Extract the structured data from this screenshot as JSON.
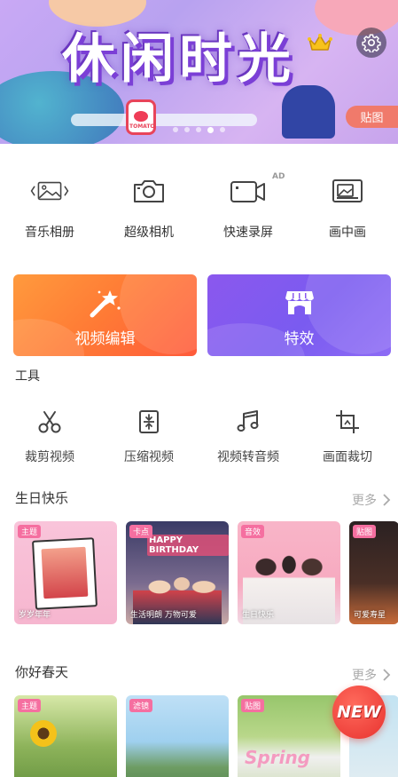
{
  "banner": {
    "title": "休闲时光",
    "sticker_tag": "贴图",
    "tomato_label": "TOMATO",
    "slide_count": 5,
    "active_slide": 3
  },
  "quick_actions": [
    {
      "label": "音乐相册",
      "icon": "photo-album-icon"
    },
    {
      "label": "超级相机",
      "icon": "camera-icon"
    },
    {
      "label": "快速录屏",
      "icon": "screen-record-icon",
      "badge": "AD"
    },
    {
      "label": "画中画",
      "icon": "picture-in-picture-icon"
    }
  ],
  "cards": {
    "edit": {
      "label": "视频编辑",
      "icon": "magic-wand-icon"
    },
    "effects": {
      "label": "特效",
      "icon": "shop-icon"
    }
  },
  "tools": {
    "label": "工具",
    "items": [
      {
        "label": "裁剪视频",
        "icon": "scissors-icon"
      },
      {
        "label": "压缩视频",
        "icon": "compress-icon"
      },
      {
        "label": "视频转音频",
        "icon": "music-note-icon"
      },
      {
        "label": "画面裁切",
        "icon": "crop-icon"
      }
    ]
  },
  "sections": [
    {
      "title": "生日快乐",
      "more": "更多",
      "items": [
        {
          "tag": "主题",
          "tag_color": "#f56fa0",
          "caption": "岁岁年年"
        },
        {
          "tag": "卡点",
          "tag_color": "#f56fa0",
          "caption": "生活明朗 万物可爱",
          "text": "HAPPY BIRTHDAY"
        },
        {
          "tag": "音效",
          "tag_color": "#f56fa0",
          "caption": "生日快乐"
        },
        {
          "tag": "贴图",
          "tag_color": "#f56fa0",
          "caption": "可爱寿星"
        }
      ]
    },
    {
      "title": "你好春天",
      "more": "更多",
      "items": [
        {
          "tag": "主题",
          "tag_color": "#f56fa0"
        },
        {
          "tag": "滤镜",
          "tag_color": "#f56fa0"
        },
        {
          "tag": "贴图",
          "tag_color": "#f56fa0",
          "text": "Spring"
        },
        {
          "tag": ""
        }
      ]
    }
  ],
  "fab": {
    "label": "NEW"
  }
}
